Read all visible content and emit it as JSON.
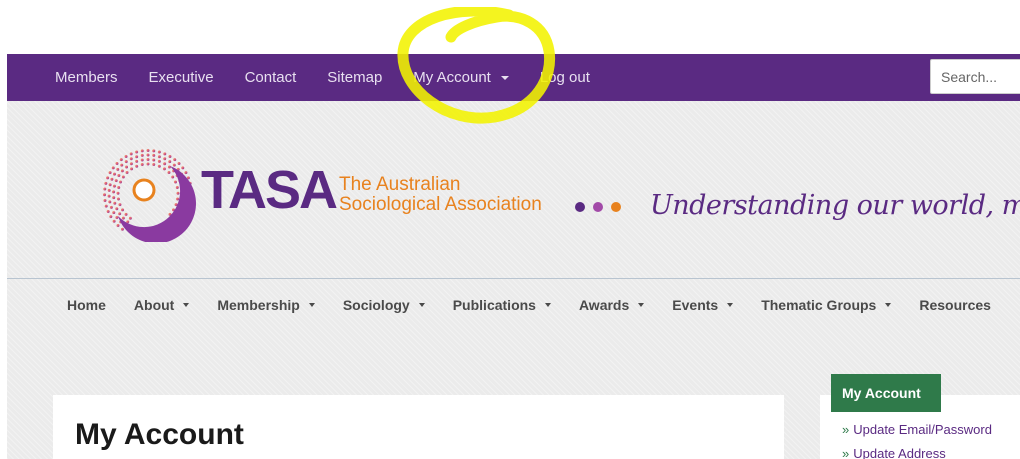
{
  "topbar": {
    "items": [
      {
        "label": "Members"
      },
      {
        "label": "Executive"
      },
      {
        "label": "Contact"
      },
      {
        "label": "Sitemap"
      },
      {
        "label": "My Account",
        "dropdown": true
      },
      {
        "label": "Log out"
      }
    ],
    "search_placeholder": "Search..."
  },
  "header": {
    "logo_text": "TASA",
    "subtitle_line1": "The Australian",
    "subtitle_line2": "Sociological Association",
    "dot_colors": [
      "#5a2a82",
      "#a24aa8",
      "#e8821e"
    ],
    "tagline": "Understanding our world, making a"
  },
  "mainnav": {
    "items": [
      {
        "label": "Home"
      },
      {
        "label": "About",
        "dropdown": true
      },
      {
        "label": "Membership",
        "dropdown": true
      },
      {
        "label": "Sociology",
        "dropdown": true
      },
      {
        "label": "Publications",
        "dropdown": true
      },
      {
        "label": "Awards",
        "dropdown": true
      },
      {
        "label": "Events",
        "dropdown": true
      },
      {
        "label": "Thematic Groups",
        "dropdown": true
      },
      {
        "label": "Resources"
      }
    ]
  },
  "content": {
    "title": "My Account"
  },
  "sidebar": {
    "title": "My Account",
    "links": [
      {
        "label": "Update Email/Password"
      },
      {
        "label": "Update Address"
      }
    ]
  },
  "colors": {
    "brand_purple": "#5a2a82",
    "brand_orange": "#e8821e",
    "sidebar_green": "#2f7a4a",
    "highlight_yellow": "#f2f200"
  }
}
